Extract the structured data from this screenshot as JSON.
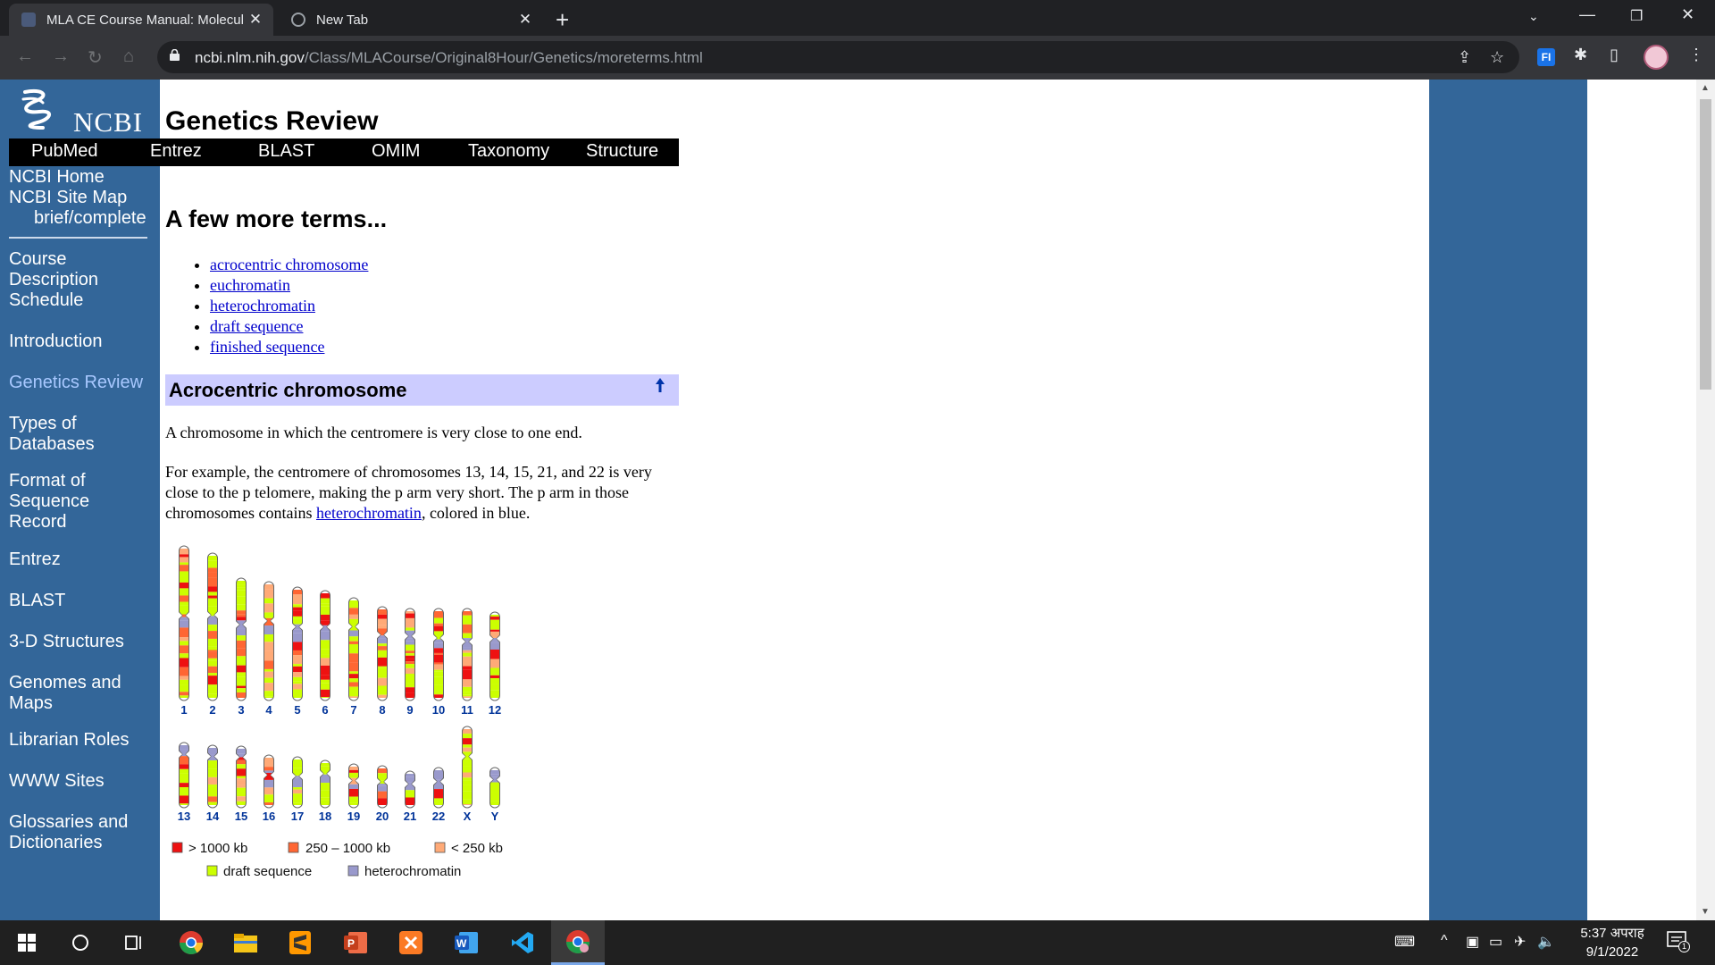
{
  "browser": {
    "tabs": [
      {
        "title": "MLA CE Course Manual: Molecul",
        "active": true
      },
      {
        "title": "New Tab",
        "active": false
      }
    ],
    "url_host": "ncbi.nlm.nih.gov",
    "url_path": "/Class/MLACourse/Original8Hour/Genetics/moreterms.html"
  },
  "page": {
    "logo_text": "NCBI",
    "title": "Genetics Review",
    "topnav": [
      "PubMed",
      "Entrez",
      "BLAST",
      "OMIM",
      "Taxonomy",
      "Structure"
    ],
    "sidebar_top": [
      "NCBI Home",
      "NCBI Site Map",
      "brief/complete"
    ],
    "sidebar": [
      {
        "label": "Course\nDescription",
        "current": false
      },
      {
        "label": "Schedule",
        "current": false
      },
      {
        "label": "Introduction",
        "current": false
      },
      {
        "label": "Genetics Review",
        "current": true
      },
      {
        "label": "Types of\nDatabases",
        "current": false
      },
      {
        "label": "Format of\nSequence\nRecord",
        "current": false
      },
      {
        "label": "Entrez",
        "current": false
      },
      {
        "label": "BLAST",
        "current": false
      },
      {
        "label": "3-D Structures",
        "current": false
      },
      {
        "label": "Genomes and\nMaps",
        "current": false
      },
      {
        "label": "Librarian Roles",
        "current": false
      },
      {
        "label": "WWW Sites",
        "current": false
      },
      {
        "label": "Glossaries and\nDictionaries",
        "current": false
      }
    ],
    "heading": "A few more terms...",
    "terms": [
      "acrocentric chromosome",
      "euchromatin",
      "heterochromatin",
      "draft sequence",
      "finished sequence"
    ],
    "section_title": "Acrocentric chromosome",
    "para1": "A chromosome in which the centromere is very close to one end.",
    "para2_before": "For example, the centromere of chromosomes 13, 14, 15, 21, and 22 is very close to the p telomere, making the p arm very short. The p arm in those chromosomes contains ",
    "para2_link": "heterochromatin",
    "para2_after": ", colored in blue."
  },
  "figure": {
    "row1_labels": [
      "1",
      "2",
      "3",
      "4",
      "5",
      "6",
      "7",
      "8",
      "9",
      "10",
      "11",
      "12"
    ],
    "row2_labels": [
      "13",
      "14",
      "15",
      "16",
      "17",
      "18",
      "19",
      "20",
      "21",
      "22",
      "X",
      "Y"
    ],
    "legend": [
      {
        "label": "> 1000 kb",
        "color": "#ee1111"
      },
      {
        "label": "250 – 1000 kb",
        "color": "#ff6633"
      },
      {
        "label": "< 250 kb",
        "color": "#ffaa77"
      },
      {
        "label": "draft sequence",
        "color": "#ccff00"
      },
      {
        "label": "heterochromatin",
        "color": "#9999cc"
      }
    ],
    "label_color": "#003399"
  },
  "taskbar": {
    "time": "5:37 अपराह",
    "date": "9/1/2022",
    "notification_count": "1"
  }
}
